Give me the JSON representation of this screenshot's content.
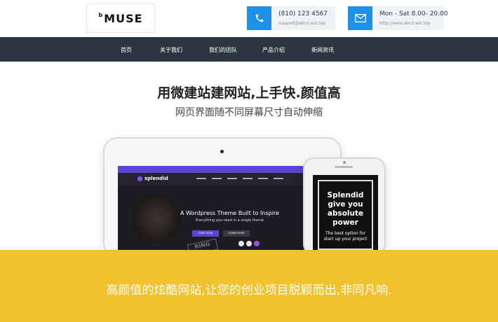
{
  "logo": {
    "mark": "b",
    "text": "MUSE"
  },
  "contact_phone": {
    "icon": "phone-icon",
    "line1": "(810) 123 4567",
    "line2": "support@abcd.wsl.top",
    "accent": "#1e90e6"
  },
  "contact_hours": {
    "icon": "envelope-icon",
    "line1": "Mon - Sat 8.00- 20.00",
    "line2": "http://www.abcd.wsl.top",
    "accent": "#1e90e6"
  },
  "nav": {
    "items": [
      "首页",
      "关于我们",
      "我们的团队",
      "产品介绍",
      "新闻资讯"
    ],
    "background": "#2c3640"
  },
  "hero": {
    "headline": "用微建站建网站,上手快.颜值高",
    "subline": "网页界面随不同屏幕尺寸自动伸缩"
  },
  "tablet_screen": {
    "brand": "splendid",
    "title": "A Wordpress Theme Built to Inspire",
    "subtitle": "Everything you need in a single theme",
    "button_primary": "START NOW",
    "button_secondary": "LEARN MORE",
    "stamp": "RING"
  },
  "phone_screen": {
    "headline_lines": [
      "Splendid",
      "give you",
      "absolute",
      "power"
    ],
    "sub_lines": [
      "The best option for",
      "start up your project"
    ]
  },
  "banner": {
    "text": "高颜值的炫酷网站,让您的创业项目脱颖而出,非同凡响.",
    "background": "#f2c12e"
  }
}
